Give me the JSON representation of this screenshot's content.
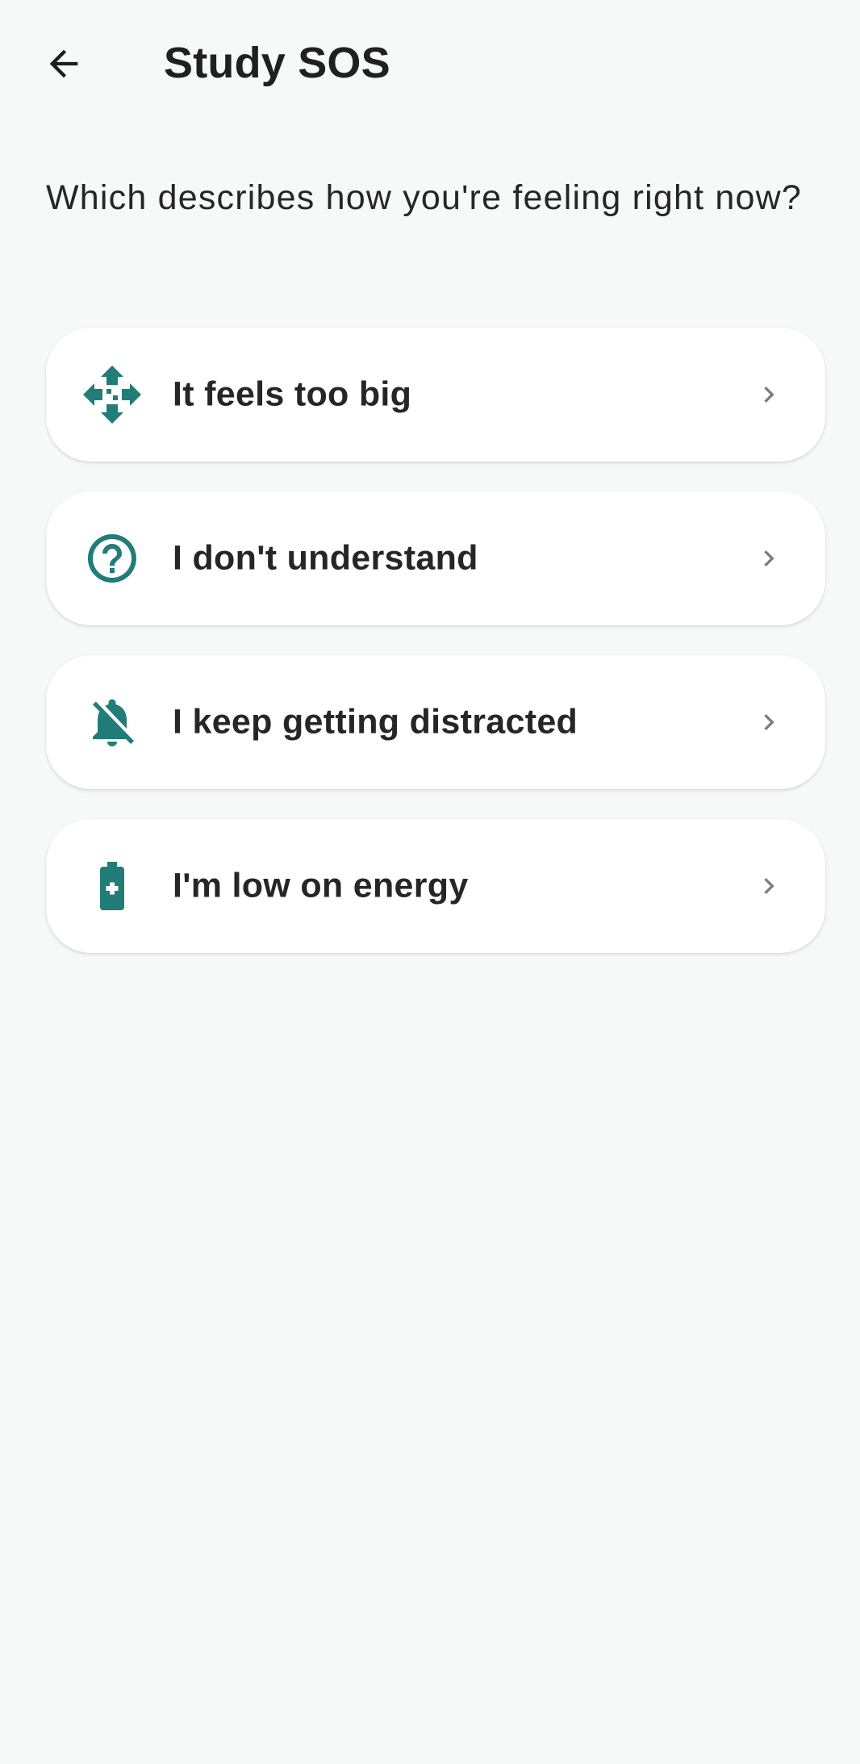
{
  "header": {
    "title": "Study SOS",
    "back_icon": "arrow-left-icon"
  },
  "prompt": "Which describes how you're feeling right now?",
  "options": [
    {
      "label": "It feels too big",
      "icon": "expand-arrows-icon"
    },
    {
      "label": "I don't understand",
      "icon": "help-circle-icon"
    },
    {
      "label": "I keep getting distracted",
      "icon": "notifications-off-icon"
    },
    {
      "label": "I'm low on energy",
      "icon": "battery-plus-icon"
    }
  ],
  "colors": {
    "accent": "#227c78",
    "background": "#f7f8f8",
    "card": "#ffffff",
    "chevron": "#7a7f7e"
  }
}
